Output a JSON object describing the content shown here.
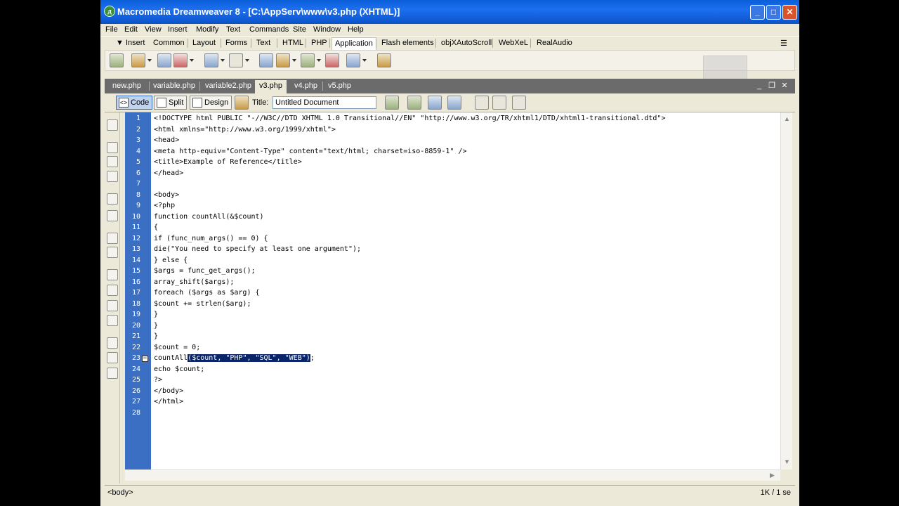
{
  "window": {
    "title": "Macromedia Dreamweaver 8 - [C:\\AppServ\\www\\v3.php (XHTML)]",
    "app_icon_glyph": "д",
    "minimize_glyph": "_",
    "maximize_glyph": "□",
    "close_glyph": "✕"
  },
  "menu": [
    "File",
    "Edit",
    "View",
    "Insert",
    "Modify",
    "Text",
    "Commands",
    "Site",
    "Window",
    "Help"
  ],
  "insert_bar": {
    "label": "▼ Insert",
    "tabs": [
      "Common",
      "Layout",
      "Forms",
      "Text",
      "HTML",
      "PHP",
      "Application",
      "Flash elements",
      "objXAutoScroll",
      "WebXeL",
      "RealAudio"
    ],
    "active_tab": "Application",
    "options_glyph": "☰"
  },
  "document_tabs": {
    "tabs": [
      "new.php",
      "variable.php",
      "variable2.php",
      "v3.php",
      "v4.php",
      "v5.php"
    ],
    "active": "v3.php",
    "restore_glyph": "❐",
    "close_glyph": "✕",
    "min_glyph": "_"
  },
  "doc_toolbar": {
    "code_label": "Code",
    "split_label": "Split",
    "design_label": "Design",
    "title_label": "Title:",
    "title_value": "Untitled Document"
  },
  "code_lines": [
    {
      "n": "1",
      "text": "<!DOCTYPE html PUBLIC \"-//W3C//DTD XHTML 1.0 Transitional//EN\" \"http://www.w3.org/TR/xhtml1/DTD/xhtml1-transitional.dtd\">"
    },
    {
      "n": "2",
      "text": "<html xmlns=\"http://www.w3.org/1999/xhtml\">"
    },
    {
      "n": "3",
      "text": "<head>"
    },
    {
      "n": "4",
      "text": "<meta http-equiv=\"Content-Type\" content=\"text/html; charset=iso-8859-1\" />"
    },
    {
      "n": "5",
      "text": "<title>Example of Reference</title>"
    },
    {
      "n": "6",
      "text": "</head>"
    },
    {
      "n": "7",
      "text": ""
    },
    {
      "n": "8",
      "text": "<body>"
    },
    {
      "n": "9",
      "text": "<?php"
    },
    {
      "n": "10",
      "text": "function countAll(&$count)"
    },
    {
      "n": "11",
      "text": "{"
    },
    {
      "n": "12",
      "text": "if (func_num_args() == 0) {"
    },
    {
      "n": "13",
      "text": "die(\"You need to specify at least one argument\");"
    },
    {
      "n": "14",
      "text": "} else {"
    },
    {
      "n": "15",
      "text": "$args = func_get_args();"
    },
    {
      "n": "16",
      "text": "array_shift($args);"
    },
    {
      "n": "17",
      "text": "foreach ($args as $arg) {"
    },
    {
      "n": "18",
      "text": "$count += strlen($arg);"
    },
    {
      "n": "19",
      "text": "}"
    },
    {
      "n": "20",
      "text": "}"
    },
    {
      "n": "21",
      "text": "}"
    },
    {
      "n": "22",
      "text": "$count = 0;"
    },
    {
      "n": "23",
      "text": "countAll",
      "selected": "($count, \"PHP\", \"SQL\", \"WEB\")",
      "after": ";"
    },
    {
      "n": "24",
      "text": "echo $count;"
    },
    {
      "n": "25",
      "text": "?>"
    },
    {
      "n": "26",
      "text": "</body>"
    },
    {
      "n": "27",
      "text": "</html>"
    },
    {
      "n": "28",
      "text": ""
    }
  ],
  "fold_glyph": "−",
  "status": {
    "tag_selector": "<body>",
    "size_info": "1K / 1 se"
  },
  "colors": {
    "titlebar": "#0b52c8",
    "gutter": "#3a6fc4",
    "selection": "#0a246a"
  }
}
